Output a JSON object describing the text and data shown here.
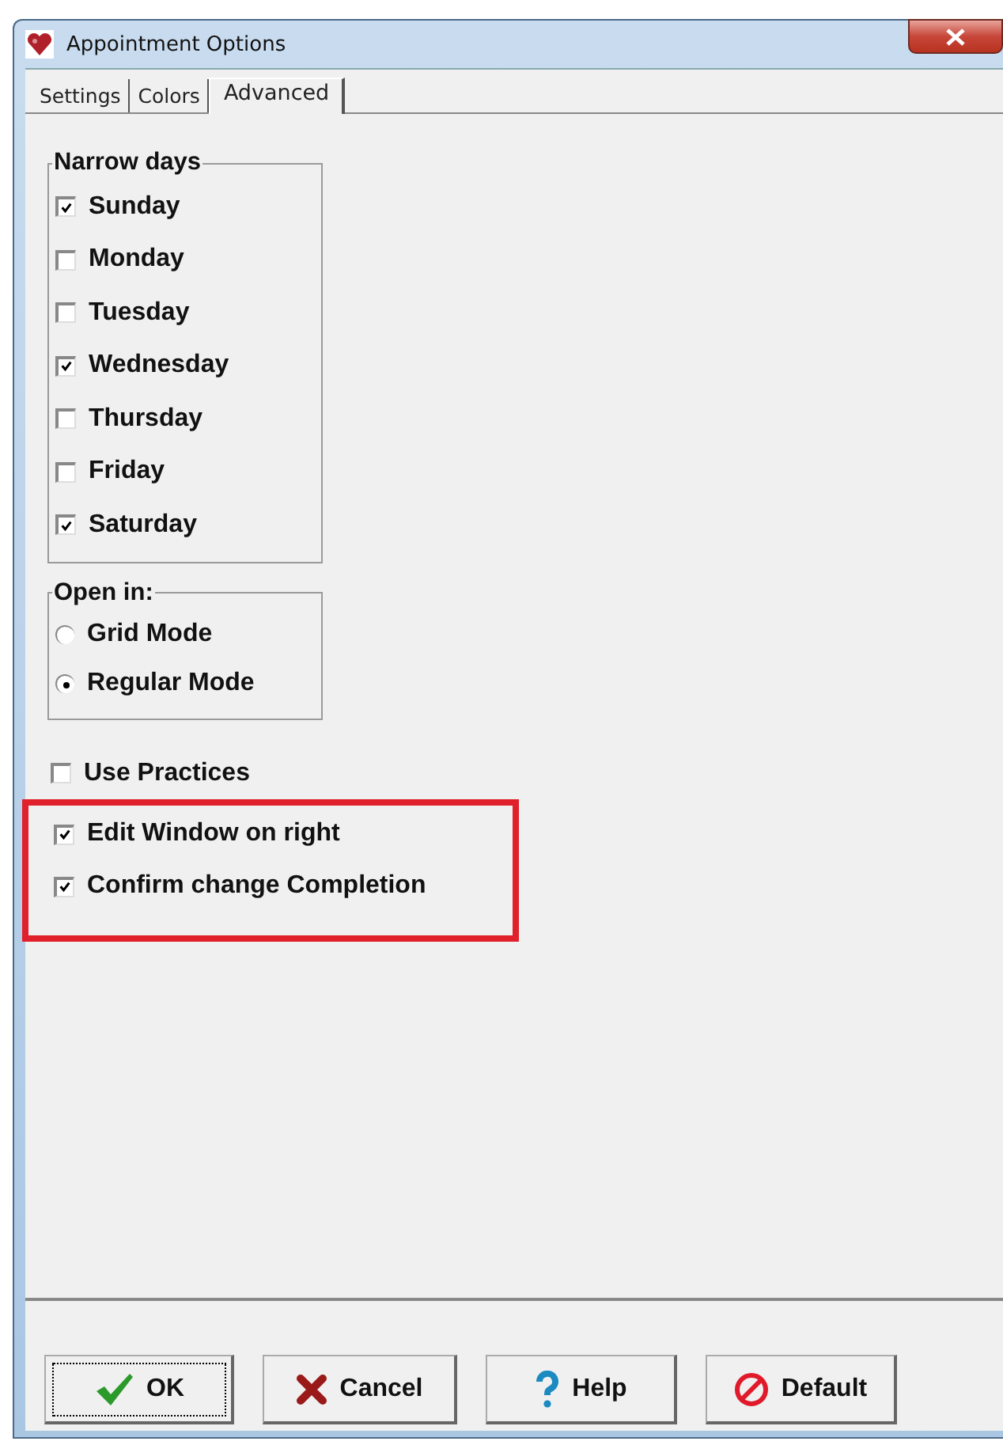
{
  "window": {
    "title": "Appointment Options"
  },
  "tabs": [
    {
      "label": "Settings",
      "selected": false
    },
    {
      "label": "Colors",
      "selected": false
    },
    {
      "label": "Advanced",
      "selected": true
    }
  ],
  "narrow_days": {
    "title": "Narrow days",
    "items": [
      {
        "label": "Sunday",
        "checked": true
      },
      {
        "label": "Monday",
        "checked": false
      },
      {
        "label": "Tuesday",
        "checked": false
      },
      {
        "label": "Wednesday",
        "checked": true
      },
      {
        "label": "Thursday",
        "checked": false
      },
      {
        "label": "Friday",
        "checked": false
      },
      {
        "label": "Saturday",
        "checked": true
      }
    ]
  },
  "open_in": {
    "title": "Open in:",
    "options": [
      {
        "label": "Grid Mode",
        "selected": false
      },
      {
        "label": "Regular Mode",
        "selected": true
      }
    ]
  },
  "options": [
    {
      "label": "Use Practices",
      "checked": false,
      "highlighted": false
    },
    {
      "label": "Edit Window on right",
      "checked": true,
      "highlighted": true
    },
    {
      "label": "Confirm change Completion",
      "checked": true,
      "highlighted": true
    }
  ],
  "buttons": [
    {
      "kind": "ok",
      "label": "OK",
      "focused": true
    },
    {
      "kind": "cancel",
      "label": "Cancel",
      "focused": false
    },
    {
      "kind": "help",
      "label": "Help",
      "focused": false
    },
    {
      "kind": "default",
      "label": "Default",
      "focused": false
    }
  ]
}
